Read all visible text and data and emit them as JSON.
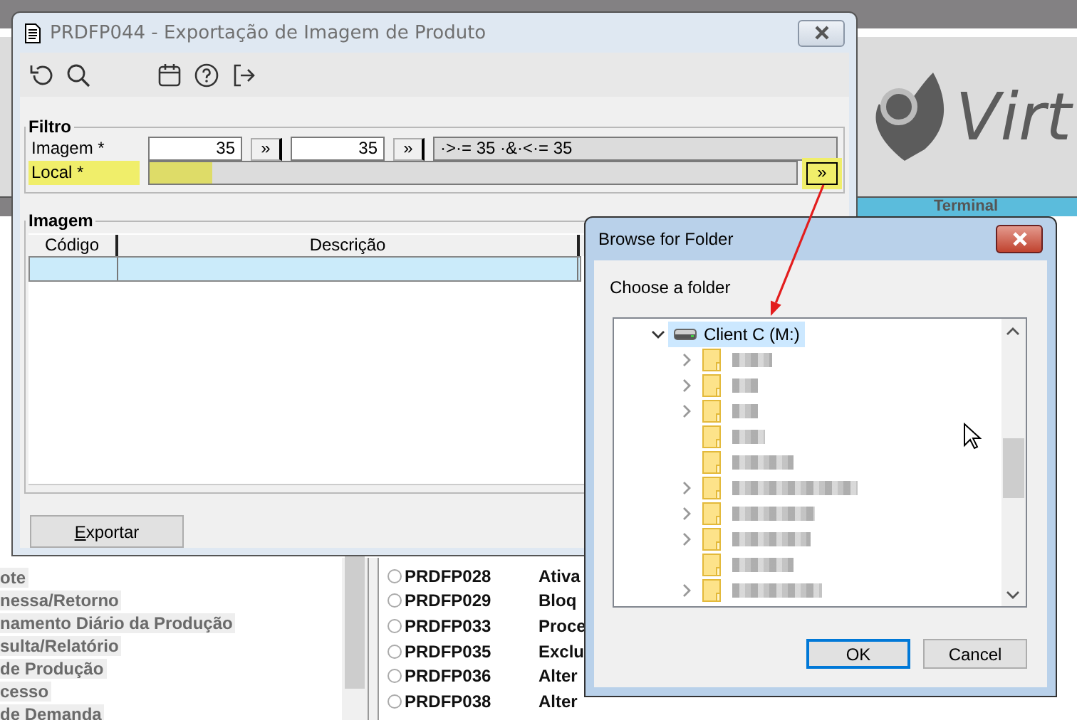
{
  "background_app": {
    "logo_text": "Virt",
    "column_header": "Terminal",
    "menu_items": [
      {
        "label": "ote"
      },
      {
        "label": "nessa/Retorno"
      },
      {
        "label": "namento Diário da Produção"
      },
      {
        "label": "sulta/Relatório"
      },
      {
        "label": "de Produção"
      },
      {
        "label": "cesso"
      },
      {
        "label": " de Demanda"
      }
    ],
    "programs": [
      {
        "code": "PRDFP028",
        "description": "Ativa",
        "selected": false
      },
      {
        "code": "PRDFP029",
        "description": "Bloq",
        "selected": false
      },
      {
        "code": "PRDFP033",
        "description": "Proce",
        "selected": false
      },
      {
        "code": "PRDFP035",
        "description": "Exclu",
        "selected": false
      },
      {
        "code": "PRDFP036",
        "description": "Alter",
        "selected": false
      },
      {
        "code": "PRDFP038",
        "description": "Alter",
        "selected": false
      }
    ]
  },
  "main_window": {
    "title": "PRDFP044 - Exportação de Imagem de Produto",
    "filter": {
      "legend": "Filtro",
      "rows": [
        {
          "kind": "range",
          "label": "Imagem *",
          "from": "35",
          "to": "35",
          "button": "»",
          "expression": "·>·= 35 ·&·<·= 35",
          "highlighted": false
        },
        {
          "kind": "path",
          "label": "Local *",
          "button": "»",
          "highlighted": true
        }
      ]
    },
    "images": {
      "legend": "Imagem",
      "columns": [
        "Código",
        "Descrição"
      ],
      "rows": [
        {
          "selected": true
        }
      ]
    },
    "export_button": "Exportar"
  },
  "folder_dialog": {
    "title": "Browse for Folder",
    "prompt": "Choose a folder",
    "root": {
      "label": "Client C (M:)",
      "expanded": true,
      "selected": true,
      "children": [
        {
          "expandable": true
        },
        {
          "expandable": true
        },
        {
          "expandable": true
        },
        {
          "expandable": false
        },
        {
          "expandable": false
        },
        {
          "expandable": true
        },
        {
          "expandable": true
        },
        {
          "expandable": true
        },
        {
          "expandable": false
        },
        {
          "expandable": true
        }
      ]
    },
    "buttons": [
      {
        "label": "OK",
        "default": true
      },
      {
        "label": "Cancel",
        "default": false
      }
    ]
  }
}
